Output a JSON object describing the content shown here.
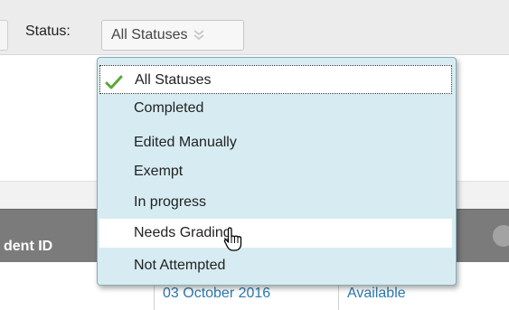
{
  "toolbar": {
    "status_label": "Status:",
    "status_select_value": "All Statuses",
    "chevron_icon": "double-chevron-down-icon"
  },
  "dropdown": {
    "options": [
      {
        "label": "All Statuses",
        "selected": true,
        "icon": "checkmark-icon"
      },
      {
        "label": "Completed"
      },
      {
        "label": "Edited Manually"
      },
      {
        "label": "Exempt"
      },
      {
        "label": "In progress"
      },
      {
        "label": "Needs Grading",
        "hovered": true
      },
      {
        "label": "Not Attempted"
      }
    ],
    "cursor_icon": "hand-pointer-icon"
  },
  "table": {
    "header": {
      "student_id": "dent ID"
    },
    "row": {
      "date": "03 October 2016",
      "availability": "Available"
    }
  },
  "colors": {
    "dropdown_bg": "#d6ecf2",
    "header_bg": "#7b7b7b",
    "link": "#2a7ab0",
    "check": "#5aa83a"
  }
}
